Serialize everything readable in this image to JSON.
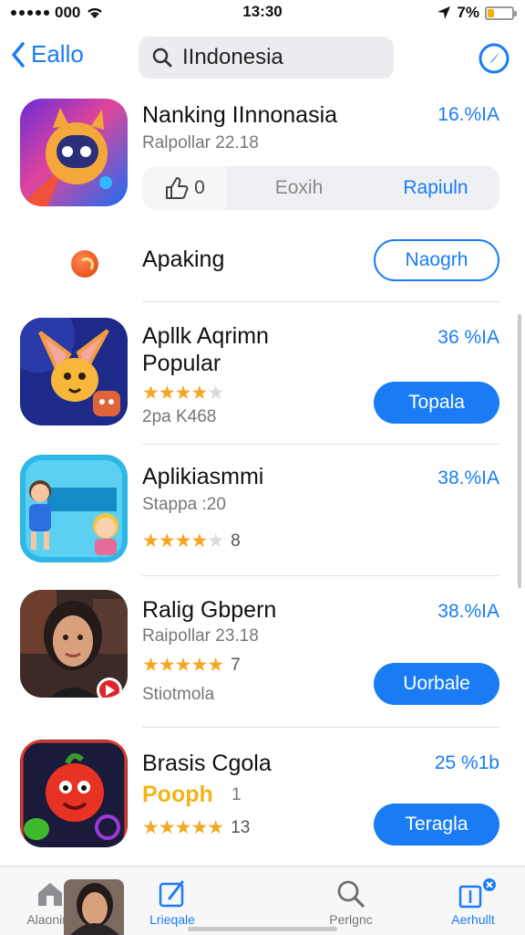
{
  "status": {
    "carrier": "000",
    "time": "13:30",
    "battery": "7%",
    "battery_level": 0.07
  },
  "nav": {
    "back_label": "Eallo",
    "search_value": "IIndonesia"
  },
  "featured": {
    "title": "Nanking IInnonasia",
    "subtitle": "Ralpollar 22.18",
    "size": "16.%IA",
    "seg": {
      "count": "0",
      "middle": "Eoxih",
      "action": "Rapiuln"
    }
  },
  "apaking": {
    "label": "Apaking",
    "button": "Naogrh"
  },
  "apps": [
    {
      "title_line1": "Apllk Aqrimn",
      "title_line2": "Popular",
      "size": "36 %IA",
      "rating": 3.5,
      "rating_count": "",
      "meta": "2pa K468",
      "button": "Topala"
    },
    {
      "title_line1": "Aplikiasmmi",
      "title_line2": "",
      "subtitle": "Stappa :20",
      "size": "38.%IA",
      "rating": 4,
      "rating_count": "8",
      "button": ""
    },
    {
      "title_line1": "Ralig Gbpern",
      "title_line2": "",
      "subtitle": "Raipollar 23.18",
      "size": "38.%IA",
      "rating": 5,
      "rating_count": "7",
      "meta": "Stiotmola",
      "button": "Uorbale"
    },
    {
      "title_line1": "Brasis Cgola",
      "title_line2": "",
      "tagline": "Pooph",
      "tagline_count": "1",
      "size": "25 %1b",
      "rating": 5,
      "rating_count": "13",
      "button": "Teragla"
    }
  ],
  "tabs": [
    {
      "label": "Alaonire",
      "icon": "home-icon",
      "active": false
    },
    {
      "label": "Lrieqale",
      "icon": "edit-icon",
      "active": true
    },
    {
      "label": "Perlgnc",
      "icon": "search-icon",
      "active": false
    },
    {
      "label": "Aerhullt",
      "icon": "updates-icon",
      "active": true
    }
  ],
  "colors": {
    "accent": "#1a7cf5",
    "star": "#f5a623"
  }
}
